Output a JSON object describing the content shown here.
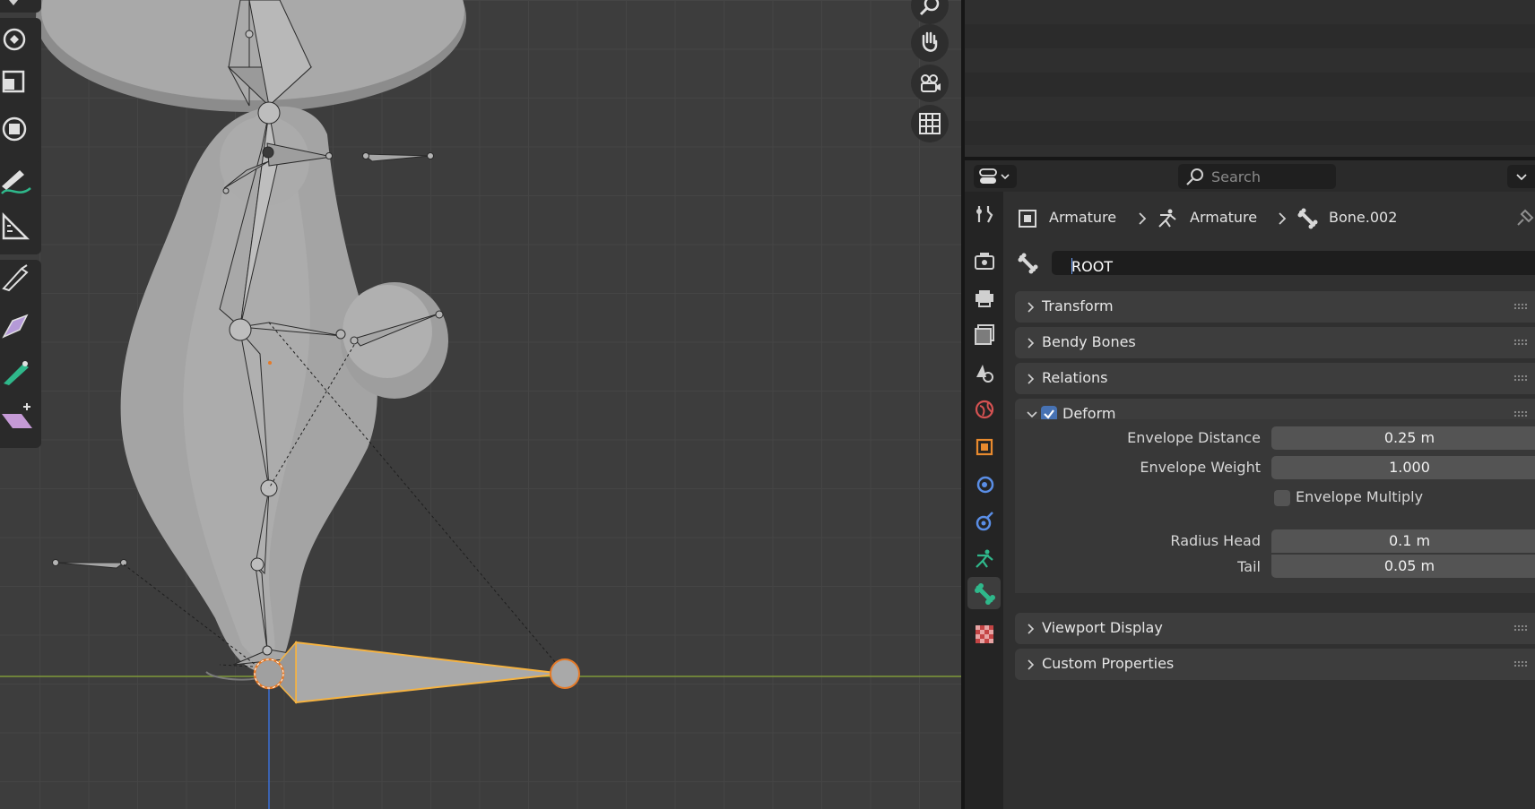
{
  "header": {
    "search_placeholder": "Search"
  },
  "breadcrumb": {
    "items": [
      "Armature",
      "Armature",
      "Bone.002"
    ]
  },
  "bone_name": "ROOT",
  "panels": {
    "transform": "Transform",
    "bendy_bones": "Bendy Bones",
    "relations": "Relations",
    "deform": "Deform",
    "viewport_display": "Viewport Display",
    "custom_properties": "Custom Properties"
  },
  "deform": {
    "enabled": true,
    "envelope_distance_label": "Envelope Distance",
    "envelope_distance_value": "0.25 m",
    "envelope_weight_label": "Envelope Weight",
    "envelope_weight_value": "1.000",
    "envelope_multiply_label": "Envelope Multiply",
    "envelope_multiply_checked": false,
    "radius_head_label": "Radius Head",
    "radius_head_value": "0.1 m",
    "tail_label": "Tail",
    "tail_value": "0.05 m"
  },
  "toolbar_icons": [
    "rotate-icon",
    "scale-icon",
    "transform-icon",
    "annotate-icon",
    "measure-icon",
    "bone-roll-icon",
    "bone-size-icon",
    "bone-envelope-icon",
    "extrude-icon"
  ],
  "nav_icons": [
    "zoom-icon",
    "pan-hand-icon",
    "camera-view-icon",
    "ortho-grid-icon"
  ],
  "property_tabs": [
    "tool-tab",
    "render-tab",
    "output-tab",
    "view-layer-tab",
    "scene-tab",
    "world-tab",
    "object-tab",
    "modifiers-tab",
    "physics-tab",
    "object-data-armature-tab",
    "bone-tab",
    "texture-tab"
  ],
  "colors": {
    "accent_blue": "#4772b3",
    "selection_orange": "#e57a28",
    "selected_bone_outline": "#f5b342",
    "armature_green": "#2fb88b",
    "object_orange": "#e88a2e",
    "x_axis": "#8aa63a",
    "z_axis": "#3b6fd6"
  }
}
